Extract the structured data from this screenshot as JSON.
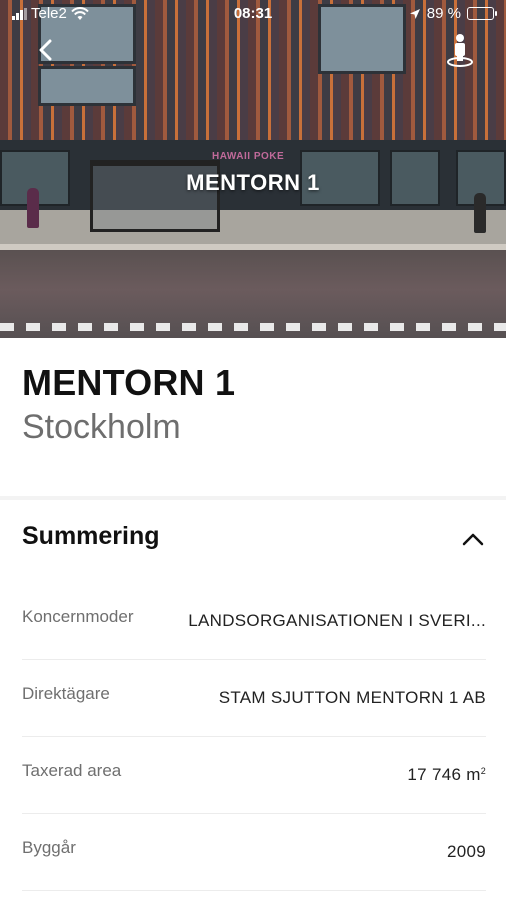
{
  "status_bar": {
    "carrier": "Tele2",
    "time": "08:31",
    "battery": "89 %",
    "battery_level": 0.89
  },
  "hero": {
    "title": "MENTORN 1",
    "storefront_sign": "HAWAII POKE"
  },
  "property": {
    "name": "MENTORN 1",
    "city": "Stockholm"
  },
  "summary": {
    "heading": "Summering",
    "rows": [
      {
        "label": "Koncernmoder",
        "value": "LANDSORGANISATIONEN I SVERI..."
      },
      {
        "label": "Direktägare",
        "value": "STAM SJUTTON MENTORN 1 AB"
      },
      {
        "label": "Taxerad area",
        "value": "17 746 m",
        "unit_sup": "2"
      },
      {
        "label": "Byggår",
        "value": "2009"
      }
    ]
  },
  "icons": {
    "back": "chevron-left-icon",
    "street_view": "street-view-person-icon",
    "collapse": "chevron-up-icon"
  }
}
